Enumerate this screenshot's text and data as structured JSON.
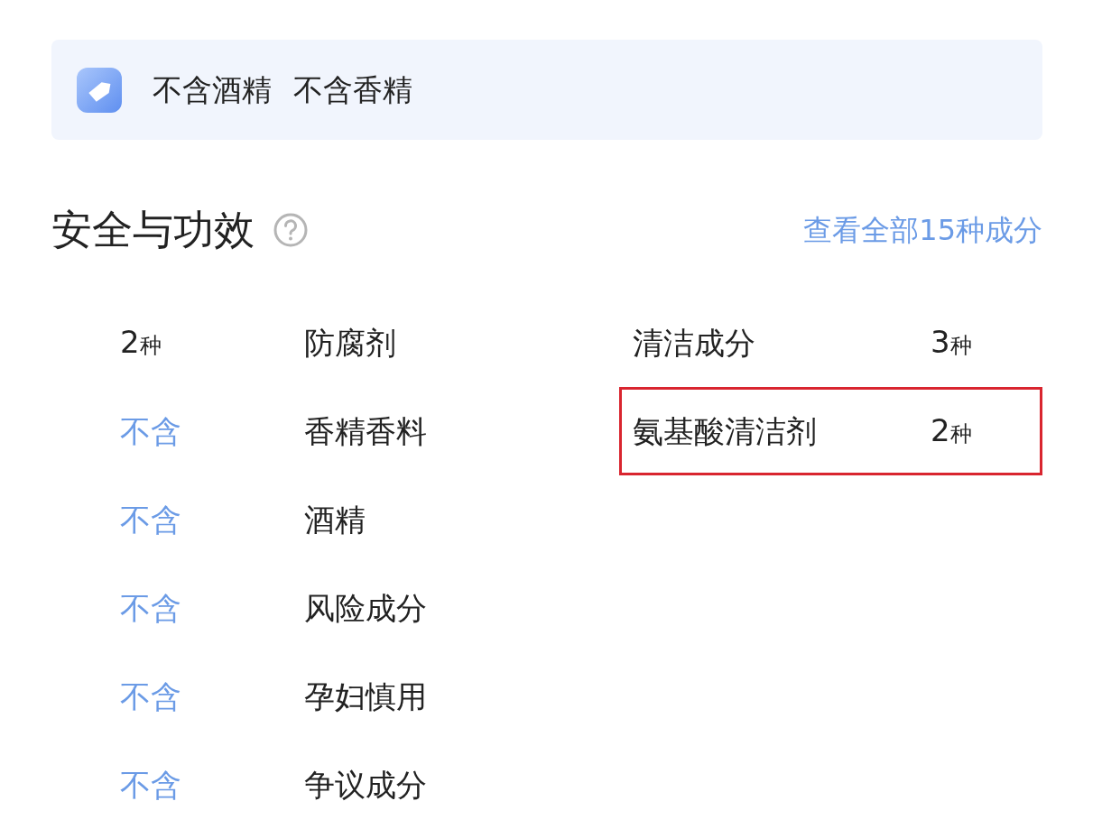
{
  "banner": {
    "tags": [
      "不含酒精",
      "不含香精"
    ]
  },
  "section": {
    "title": "安全与功效",
    "link": "查看全部15种成分"
  },
  "left_rows": [
    {
      "kind": "count",
      "value": "2",
      "unit": "种",
      "label": "防腐剂"
    },
    {
      "kind": "none",
      "value": "不含",
      "label": "香精香料"
    },
    {
      "kind": "none",
      "value": "不含",
      "label": "酒精"
    },
    {
      "kind": "none",
      "value": "不含",
      "label": "风险成分"
    },
    {
      "kind": "none",
      "value": "不含",
      "label": "孕妇慎用"
    },
    {
      "kind": "none",
      "value": "不含",
      "label": "争议成分"
    }
  ],
  "right_rows": [
    {
      "label": "清洁成分",
      "value": "3",
      "unit": "种",
      "highlighted": false
    },
    {
      "label": "氨基酸清洁剂",
      "value": "2",
      "unit": "种",
      "highlighted": true
    }
  ]
}
